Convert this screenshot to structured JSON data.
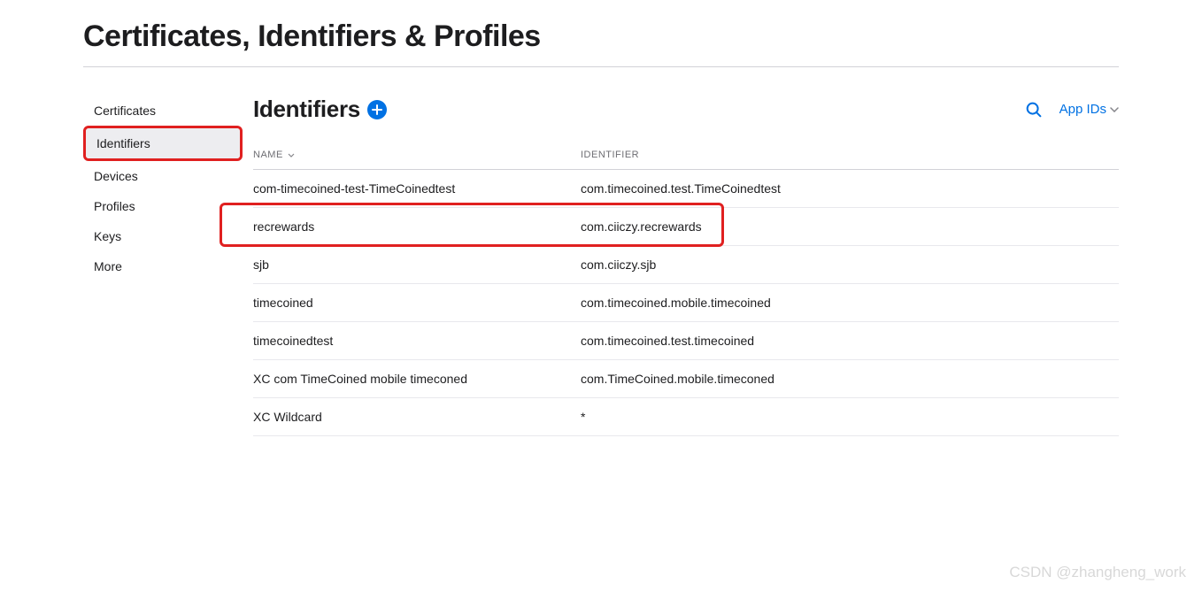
{
  "page_title": "Certificates, Identifiers & Profiles",
  "sidebar": {
    "items": [
      {
        "label": "Certificates",
        "active": false
      },
      {
        "label": "Identifiers",
        "active": true
      },
      {
        "label": "Devices",
        "active": false
      },
      {
        "label": "Profiles",
        "active": false
      },
      {
        "label": "Keys",
        "active": false
      },
      {
        "label": "More",
        "active": false
      }
    ]
  },
  "main": {
    "section_title": "Identifiers",
    "dropdown_label": "App IDs",
    "table": {
      "columns": {
        "name": "NAME",
        "identifier": "IDENTIFIER"
      },
      "rows": [
        {
          "name": "com-timecoined-test-TimeCoinedtest",
          "identifier": "com.timecoined.test.TimeCoinedtest"
        },
        {
          "name": "recrewards",
          "identifier": "com.ciiczy.recrewards"
        },
        {
          "name": "sjb",
          "identifier": "com.ciiczy.sjb"
        },
        {
          "name": "timecoined",
          "identifier": "com.timecoined.mobile.timecoined"
        },
        {
          "name": "timecoinedtest",
          "identifier": "com.timecoined.test.timecoined"
        },
        {
          "name": "XC com TimeCoined mobile timeconed",
          "identifier": "com.TimeCoined.mobile.timeconed"
        },
        {
          "name": "XC Wildcard",
          "identifier": "*"
        }
      ],
      "highlighted_row_index": 1
    }
  },
  "watermark": "CSDN @zhangheng_work",
  "highlights": {
    "sidebar_active": true
  }
}
